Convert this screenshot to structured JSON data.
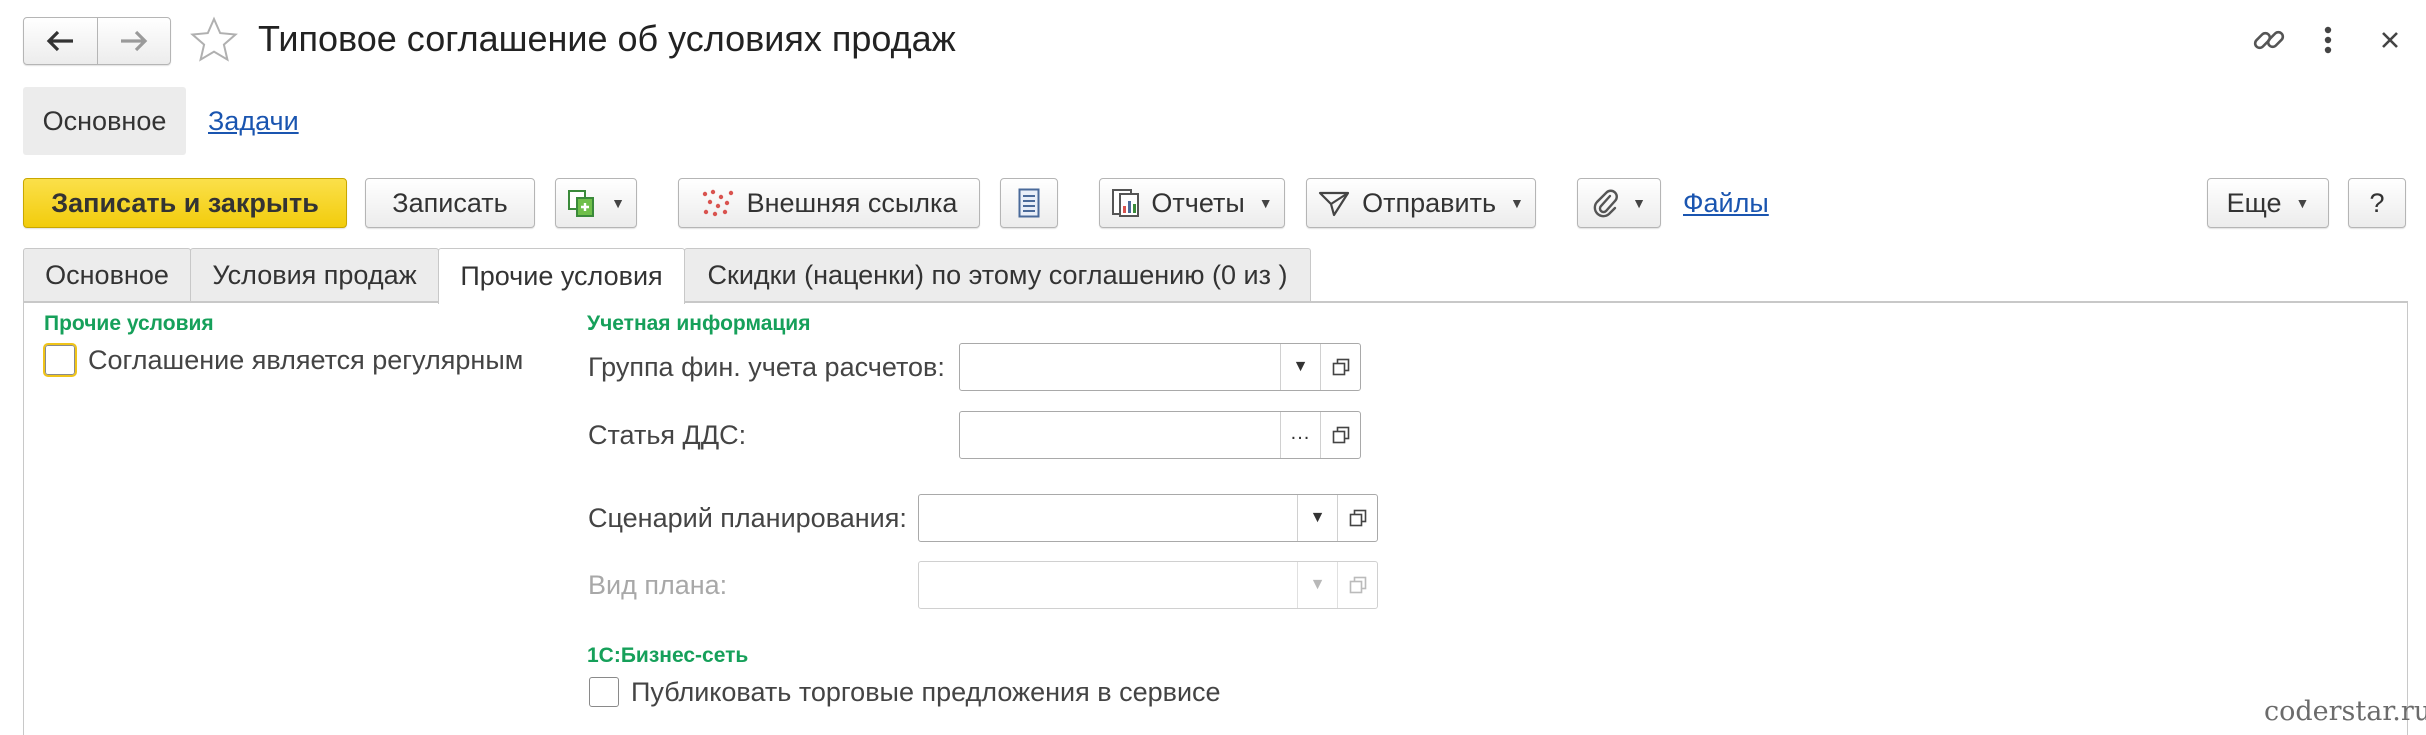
{
  "window": {
    "title": "Типовое соглашение об условиях продаж"
  },
  "sections": {
    "main_label": "Основное",
    "tasks_label": "Задачи"
  },
  "toolbar": {
    "save_close_label": "Записать и закрыть",
    "save_label": "Записать",
    "external_link_label": "Внешняя ссылка",
    "reports_label": "Отчеты",
    "send_label": "Отправить",
    "files_label": "Файлы",
    "more_label": "Еще",
    "help_label": "?"
  },
  "tabs": [
    {
      "label": "Основное",
      "active": false
    },
    {
      "label": "Условия продаж",
      "active": false
    },
    {
      "label": "Прочие условия",
      "active": true
    },
    {
      "label": "Скидки (наценки) по этому соглашению (0 из )",
      "active": false
    }
  ],
  "other_conditions": {
    "group_title": "Прочие условия",
    "regular_label": "Соглашение является регулярным",
    "regular_checked": false
  },
  "accounting": {
    "group_title": "Учетная информация",
    "fin_group_label": "Группа фин. учета расчетов:",
    "fin_group_value": "",
    "dds_label": "Статья ДДС:",
    "dds_value": "",
    "scenario_label": "Сценарий планирования:",
    "scenario_value": "",
    "plan_type_label": "Вид плана:",
    "plan_type_value": ""
  },
  "business_network": {
    "group_title": "1С:Бизнес-сеть",
    "publish_label": "Публиковать торговые предложения в сервисе",
    "publish_checked": false
  },
  "watermark": "coderstar.ru",
  "colors": {
    "accent_yellow": "#f5d41e",
    "group_title_green": "#16a05a",
    "link_blue": "#1a55b0"
  },
  "icons": [
    "back-arrow-icon",
    "forward-arrow-icon",
    "star-icon",
    "link-icon",
    "kebab-menu-icon",
    "close-icon",
    "create-based-on-icon",
    "external-link-icon",
    "document-list-icon",
    "reports-icon",
    "send-icon",
    "paperclip-icon",
    "dropdown-arrow-icon",
    "open-icon"
  ]
}
